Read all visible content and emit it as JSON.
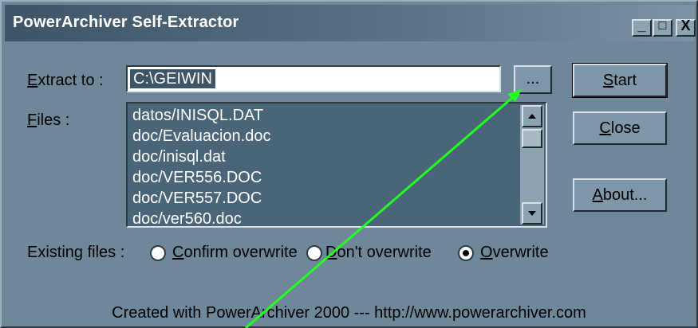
{
  "window": {
    "title": "PowerArchiver Self-Extractor",
    "controls": {
      "minimize": "_",
      "maximize": "□",
      "close": "X"
    }
  },
  "extract": {
    "label_underlined": "E",
    "label_rest": "xtract to :",
    "value": "C:\\GEIWIN",
    "browse_label": "..."
  },
  "files": {
    "label_underlined": "F",
    "label_rest": "iles :",
    "items": [
      "datos/INISQL.DAT",
      "doc/Evaluacion.doc",
      "doc/inisql.dat",
      "doc/VER556.DOC",
      "doc/VER557.DOC",
      "doc/ver560.doc"
    ]
  },
  "buttons": {
    "start": {
      "underlined": "S",
      "rest": "tart"
    },
    "close": {
      "underlined": "C",
      "rest": "lose"
    },
    "about": {
      "underlined": "A",
      "rest": "bout..."
    }
  },
  "existing": {
    "label": "Existing files :",
    "options": [
      {
        "underlined": "C",
        "rest": "onfirm overwrite",
        "selected": false
      },
      {
        "underlined": "D",
        "rest": "on't overwrite",
        "selected": false
      },
      {
        "underlined": "O",
        "rest": "verwrite",
        "selected": true
      }
    ]
  },
  "footer": "Created with PowerArchiver 2000 --- http://www.powerarchiver.com",
  "colors": {
    "window_bg": "#6f8899",
    "annotation_arrow": "#22ff22"
  }
}
